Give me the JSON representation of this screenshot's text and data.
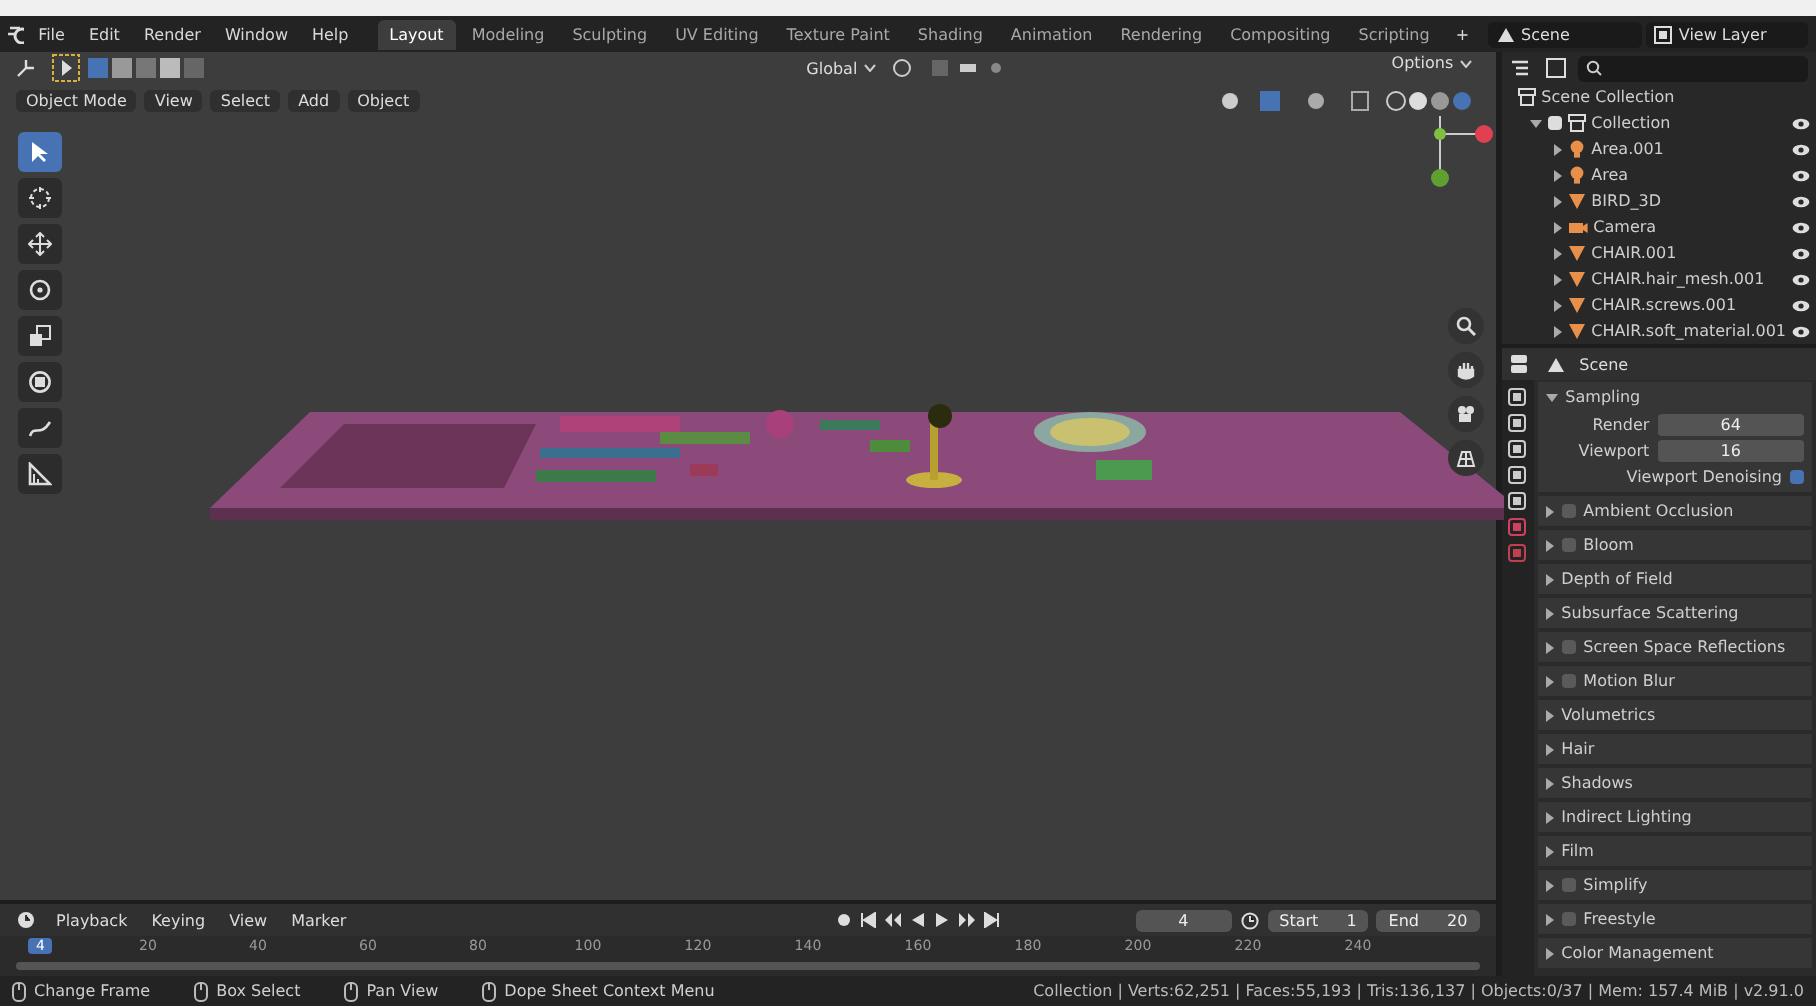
{
  "menu": [
    "File",
    "Edit",
    "Render",
    "Window",
    "Help"
  ],
  "workspaces": [
    {
      "label": "Layout",
      "selected": true
    },
    {
      "label": "Modeling",
      "selected": false
    },
    {
      "label": "Sculpting",
      "selected": false
    },
    {
      "label": "UV Editing",
      "selected": false
    },
    {
      "label": "Texture Paint",
      "selected": false
    },
    {
      "label": "Shading",
      "selected": false
    },
    {
      "label": "Animation",
      "selected": false
    },
    {
      "label": "Rendering",
      "selected": false
    },
    {
      "label": "Compositing",
      "selected": false
    },
    {
      "label": "Scripting",
      "selected": false
    }
  ],
  "add_workspace": "+",
  "scene": "Scene",
  "view_layer": "View Layer",
  "viewport": {
    "orientation": "Global",
    "options": "Options",
    "mode": "Object Mode",
    "menus": [
      "View",
      "Select",
      "Add",
      "Object"
    ]
  },
  "outliner": {
    "root": "Scene Collection",
    "items": [
      {
        "label": "Collection",
        "checked": true,
        "expanded": true,
        "children": [
          {
            "label": "Area.001",
            "kind": "light"
          },
          {
            "label": "Area",
            "kind": "light"
          },
          {
            "label": "BIRD_3D",
            "kind": "mesh"
          },
          {
            "label": "Camera",
            "kind": "camera"
          },
          {
            "label": "CHAIR.001",
            "kind": "mesh"
          },
          {
            "label": "CHAIR.hair_mesh.001",
            "kind": "mesh"
          },
          {
            "label": "CHAIR.screws.001",
            "kind": "mesh"
          },
          {
            "label": "CHAIR.soft_material.001",
            "kind": "mesh"
          }
        ]
      }
    ]
  },
  "properties": {
    "context": "Scene",
    "panels": [
      {
        "label": "Sampling",
        "kind": "plain",
        "expanded": true,
        "fields": [
          {
            "label": "Render",
            "value": "64"
          },
          {
            "label": "Viewport",
            "value": "16"
          }
        ],
        "toggle": {
          "label": "Viewport Denoising",
          "checked": true
        }
      },
      {
        "label": "Ambient Occlusion",
        "kind": "toggle",
        "expanded": false,
        "checked": false
      },
      {
        "label": "Bloom",
        "kind": "toggle",
        "expanded": false,
        "checked": false
      },
      {
        "label": "Depth of Field",
        "kind": "plain",
        "expanded": false
      },
      {
        "label": "Subsurface Scattering",
        "kind": "plain",
        "expanded": false
      },
      {
        "label": "Screen Space Reflections",
        "kind": "toggle",
        "expanded": false,
        "checked": false
      },
      {
        "label": "Motion Blur",
        "kind": "toggle",
        "expanded": false,
        "checked": false
      },
      {
        "label": "Volumetrics",
        "kind": "plain",
        "expanded": false
      },
      {
        "label": "Hair",
        "kind": "plain",
        "expanded": false
      },
      {
        "label": "Shadows",
        "kind": "plain",
        "expanded": false
      },
      {
        "label": "Indirect Lighting",
        "kind": "plain",
        "expanded": false
      },
      {
        "label": "Film",
        "kind": "plain",
        "expanded": false
      },
      {
        "label": "Simplify",
        "kind": "toggle",
        "expanded": false,
        "checked": false
      },
      {
        "label": "Freestyle",
        "kind": "toggle",
        "expanded": false,
        "checked": false
      },
      {
        "label": "Color Management",
        "kind": "plain",
        "expanded": false
      }
    ]
  },
  "timeline": {
    "menus": [
      "Playback",
      "Keying",
      "View",
      "Marker"
    ],
    "current_frame": "4",
    "start_label": "Start",
    "start": "1",
    "end_label": "End",
    "end": "20",
    "playhead": "4",
    "ticks": [
      "20",
      "40",
      "60",
      "80",
      "100",
      "120",
      "140",
      "160",
      "180",
      "200",
      "220",
      "240"
    ]
  },
  "status_bar": {
    "hints": [
      "Change Frame",
      "Box Select",
      "Pan View",
      "Dope Sheet Context Menu"
    ],
    "stats": "Collection | Verts:62,251 | Faces:55,193 | Tris:136,137 | Objects:0/37 | Mem: 157.4 MiB | v2.91.0"
  }
}
